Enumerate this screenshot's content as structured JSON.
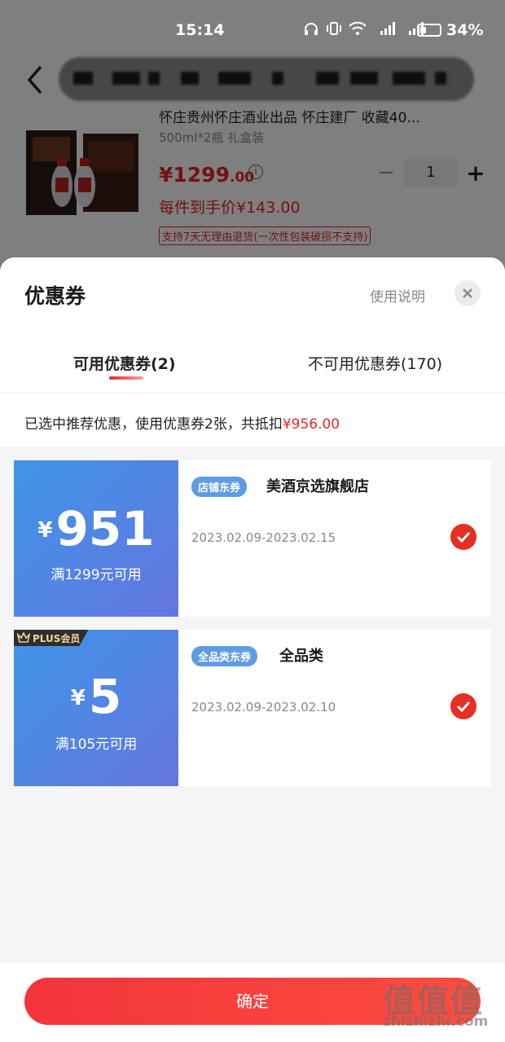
{
  "status_bar": {
    "time": "15:14",
    "battery": "34%",
    "battery_level": 0.34
  },
  "product": {
    "name": "怀庄贵州怀庄酒业出品 怀庄建厂 收藏40...",
    "spec": "500ml*2瓶 礼盒装",
    "price_int": "¥1299",
    "price_dec": ".00",
    "final_price": "每件到手价¥143.00",
    "return_policy": "支持7天无理由退货(一次性包装破损不支持)",
    "quantity": "1",
    "minus": "−",
    "plus": "+"
  },
  "sheet": {
    "title": "优惠券",
    "help": "使用说明",
    "tabs": {
      "available": "可用优惠券(2)",
      "unavailable": "不可用优惠券(170)"
    },
    "summary_text": "已选中推荐优惠，使用优惠券2张，共抵扣",
    "summary_amount": "¥956.00",
    "confirm": "确定"
  },
  "coupons": [
    {
      "currency": "¥",
      "value": "951",
      "condition": "满1299元可用",
      "tag": "店铺东券",
      "scope": "美酒京选旗舰店",
      "dates": "2023.02.09-2023.02.15",
      "selected": true
    },
    {
      "currency": "¥",
      "value": "5",
      "condition": "满105元可用",
      "tag": "全品类东券",
      "scope": "全品类",
      "dates": "2023.02.09-2023.02.10",
      "selected": true,
      "badge": "PLUS会员"
    }
  ],
  "watermark": {
    "logo": "值值值",
    "site": "zhizhizhi.com"
  },
  "colors": {
    "accent": "#e5252a",
    "coupon_gradient_start": "#3f95e8",
    "coupon_gradient_end": "#6475e0",
    "tag_blue": "#5f9be3"
  }
}
